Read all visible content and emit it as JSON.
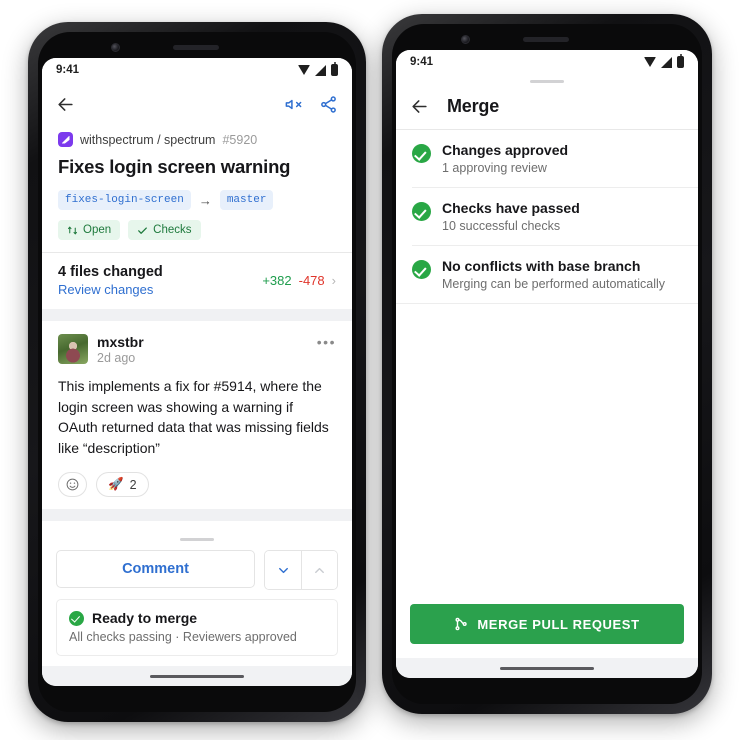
{
  "left_phone": {
    "status_bar": {
      "time": "9:41",
      "icons": [
        "wifi-icon",
        "cellular-icon",
        "battery-icon"
      ]
    },
    "appbar": {
      "back": "back-arrow-icon",
      "mute": "mute-icon",
      "share": "share-icon"
    },
    "pr": {
      "repo_owner_repo": "withspectrum / spectrum",
      "number": "#5920",
      "title": "Fixes login screen warning",
      "head_branch": "fixes-login-screen",
      "branch_arrow": "→",
      "base_branch": "master",
      "state_label": "Open",
      "checks_label": "Checks"
    },
    "files": {
      "title": "4 files changed",
      "link": "Review changes",
      "additions": "+382",
      "deletions": "-478",
      "chevron": "›"
    },
    "comment": {
      "author": "mxstbr",
      "time": "2d ago",
      "more": "•••",
      "body": "This implements a fix for #5914, where the login screen was showing a warning if OAuth returned data that was missing fields like “description”",
      "add_reaction": "☺",
      "reaction_emoji": "🚀",
      "reaction_count": "2"
    },
    "sheet": {
      "comment_button": "Comment",
      "collapse_down": "chevron-down-icon",
      "collapse_up": "chevron-up-icon",
      "status_title": "Ready to merge",
      "status_sub": "All checks passing · Reviewers approved"
    }
  },
  "right_phone": {
    "status_bar": {
      "time": "9:41",
      "icons": [
        "wifi-icon",
        "cellular-icon",
        "battery-icon"
      ]
    },
    "appbar": {
      "back": "back-arrow-icon",
      "title": "Merge"
    },
    "checks": [
      {
        "title": "Changes approved",
        "sub": "1 approving review"
      },
      {
        "title": "Checks have passed",
        "sub": "10 successful checks"
      },
      {
        "title": "No conflicts with base branch",
        "sub": "Merging can be performed automatically"
      }
    ],
    "merge_button": {
      "label": "MERGE PULL REQUEST",
      "icon": "git-merge-icon"
    }
  },
  "colors": {
    "accent_blue": "#2f6fd0",
    "success_green": "#29a745",
    "merge_green": "#2ba14d",
    "additions": "#1f9d4d",
    "deletions": "#e0352b",
    "brand_purple": "#7c3aed"
  }
}
